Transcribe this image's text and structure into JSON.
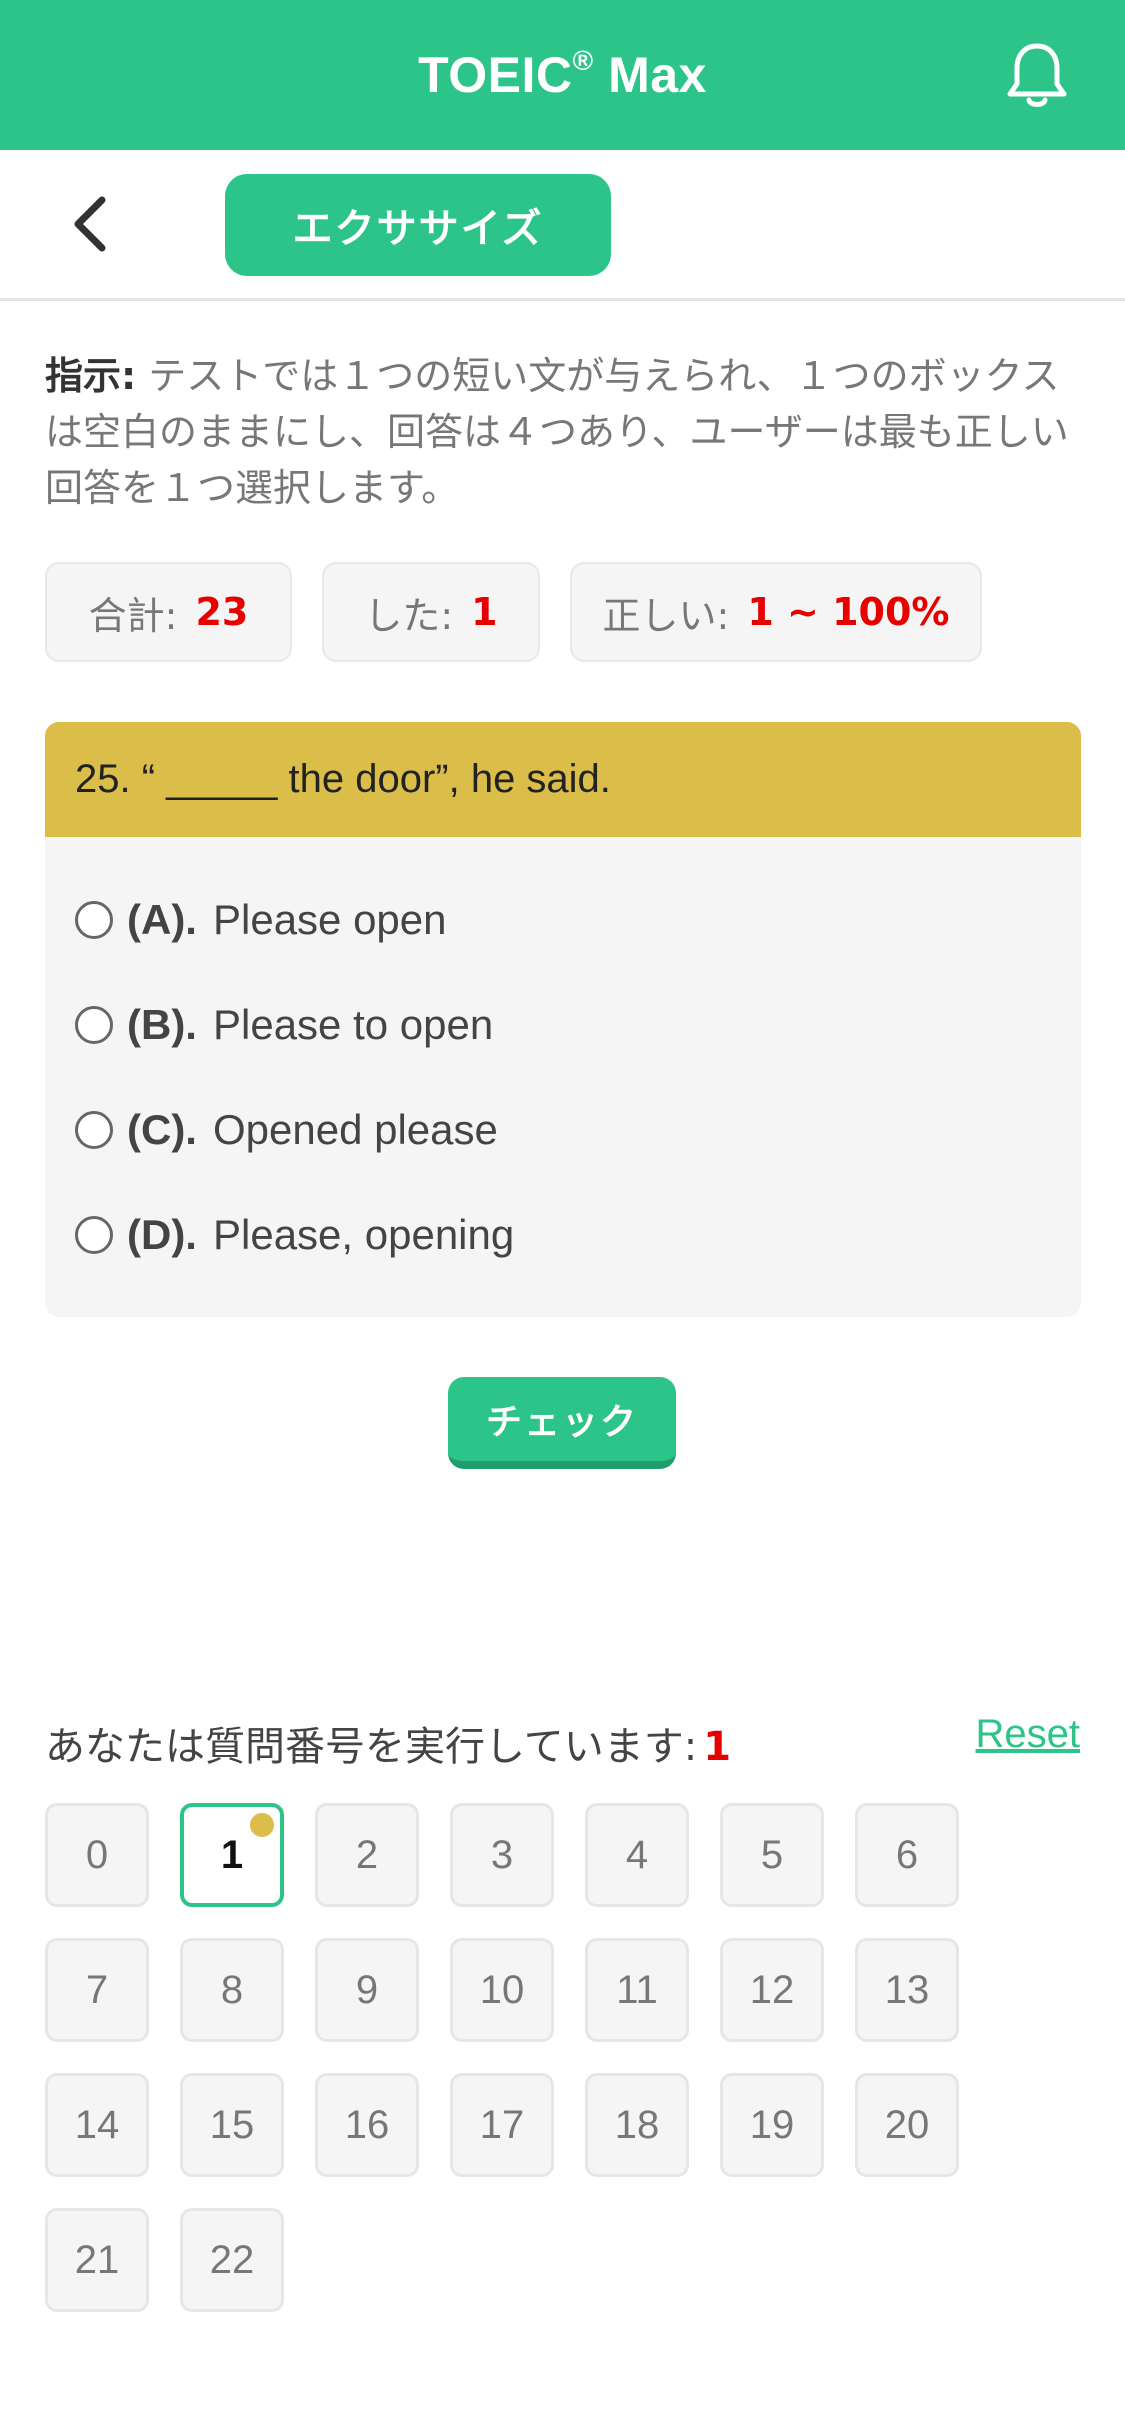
{
  "header": {
    "title": "TOEIC",
    "title_reg": "®",
    "title_suffix": " Max"
  },
  "subnav": {
    "exercise_label": "エクササイズ"
  },
  "instruction": {
    "label": "指示:",
    "text": " テストでは１つの短い文が与えられ、１つのボックスは空白のままにし、回答は４つあり、ユーザーは最も正しい回答を１つ選択します。"
  },
  "stats": [
    {
      "label": "合計:",
      "value": "23"
    },
    {
      "label": "した:",
      "value": "1"
    },
    {
      "label": "正しい:",
      "value": "1 ~ 100%"
    }
  ],
  "question": {
    "text": "25. “ _____ the door”, he said.",
    "options": [
      {
        "letter": "(A).",
        "text": "Please open"
      },
      {
        "letter": "(B).",
        "text": "Please to open"
      },
      {
        "letter": "(C).",
        "text": "Opened please"
      },
      {
        "letter": "(D).",
        "text": "Please, opening"
      }
    ]
  },
  "check_label": "チェック",
  "running": {
    "label": "あなたは質問番号を実行しています:",
    "number": "1",
    "reset_label": "Reset"
  },
  "grid": [
    "0",
    "1",
    "2",
    "3",
    "4",
    "5",
    "6",
    "7",
    "8",
    "9",
    "10",
    "11",
    "12",
    "13",
    "14",
    "15",
    "16",
    "17",
    "18",
    "19",
    "20",
    "21",
    "22"
  ],
  "colors": {
    "accent": "#2dc48a",
    "question_header": "#dbbd4a",
    "highlight": "#e60000"
  },
  "icons": {
    "notification": "bell-icon",
    "back": "chevron-left-icon"
  }
}
